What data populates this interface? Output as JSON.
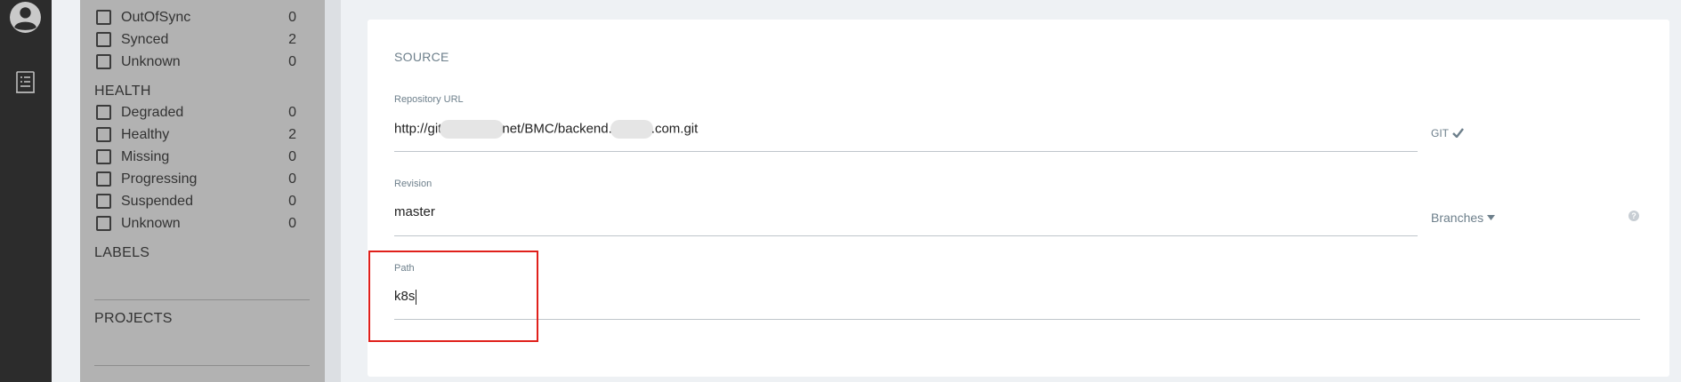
{
  "filters": {
    "sync_items": [
      {
        "label": "OutOfSync",
        "count": "0"
      },
      {
        "label": "Synced",
        "count": "2"
      },
      {
        "label": "Unknown",
        "count": "0"
      }
    ],
    "health_heading": "HEALTH",
    "health_items": [
      {
        "label": "Degraded",
        "count": "0"
      },
      {
        "label": "Healthy",
        "count": "2"
      },
      {
        "label": "Missing",
        "count": "0"
      },
      {
        "label": "Progressing",
        "count": "0"
      },
      {
        "label": "Suspended",
        "count": "0"
      },
      {
        "label": "Unknown",
        "count": "0"
      }
    ],
    "labels_heading": "LABELS",
    "projects_heading": "PROJECTS"
  },
  "source": {
    "title": "SOURCE",
    "repo_url": {
      "label": "Repository URL",
      "part1": "http://git",
      "part2": "net/BMC/backend.",
      "part3": ".com.git",
      "type_label": "GIT"
    },
    "revision": {
      "label": "Revision",
      "value": "master",
      "branches_label": "Branches"
    },
    "path": {
      "label": "Path",
      "value": "k8s"
    }
  },
  "colors": {
    "highlight": "#e0201b",
    "rail": "#2c2c2c",
    "panel": "#b2b2b2"
  }
}
